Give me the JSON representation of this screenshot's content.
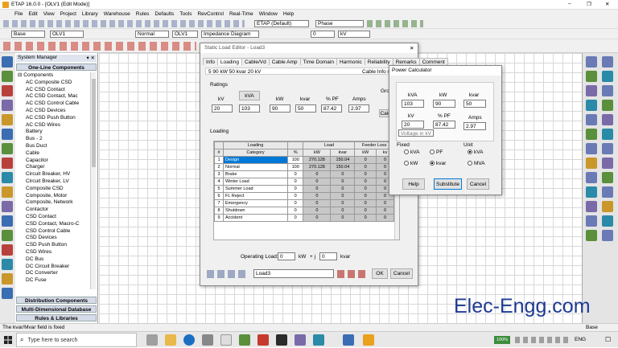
{
  "app": {
    "title": "ETAP 16.0.0 - [OLV1 (Edit Mode)]",
    "win_min": "–",
    "win_max": "❐",
    "win_close": "✕"
  },
  "menu": [
    "File",
    "Edit",
    "View",
    "Project",
    "Library",
    "Warehouse",
    "Rules",
    "Defaults",
    "Tools",
    "RevControl",
    "Real-Time",
    "Window",
    "Help"
  ],
  "toolbar": {
    "base": "Base",
    "olv": "OLV1",
    "normal": "Normal",
    "olv2": "OLV1",
    "impedance": "Impedance Diagram",
    "etap_default": "ETAP (Default)",
    "phase": "Phase",
    "kv": "kV",
    "zoom_val": "0"
  },
  "sysmgr": {
    "title": "System Manager",
    "pin": "▾ ✕",
    "oneline": "One-Line Components",
    "components": "Components",
    "items": [
      "AC Composite CSD",
      "AC CSD Contact",
      "AC CSD Contact, Mac",
      "AC CSD Control Cable",
      "AC CSD Devices",
      "AC CSD Push Button",
      "AC CSD Wires",
      "Battery",
      "Bus - 2",
      "Bus Duct",
      "Cable",
      "Capacitor",
      "Charger",
      "Circuit Breaker, HV",
      "Circuit Breaker, LV",
      "Composite CSD",
      "Composite, Motor",
      "Composite, Network",
      "Contactor",
      "CSD Contact",
      "CSD Contact, Macro-C",
      "CSD Control Cable",
      "CSD Devices",
      "CSD Push Button",
      "CSD Wires",
      "DC Bus",
      "DC Circuit Breaker",
      "DC Converter",
      "DC Fuse"
    ],
    "distribution": "Distribution Components",
    "multidim": "Multi-Dimensional Database",
    "rules": "Rules & Libraries"
  },
  "sle": {
    "title": "Static Load Editor - Load3",
    "close": "✕",
    "tabs": [
      "Info",
      "Loading",
      "Cable/Vd",
      "Cable Amp",
      "Time Domain",
      "Harmonic",
      "Reliability",
      "Remarks",
      "Comment"
    ],
    "summary": "5  90 kW  50 kvar  20 kV",
    "cable_info": "Cable Info not a",
    "ratings": "Ratings",
    "rating_headers": [
      "kV",
      "kVA",
      "kW",
      "kvar",
      "% PF",
      "Amps"
    ],
    "rating_values": [
      "20",
      "103",
      "90",
      "50",
      "87.42",
      "2.97"
    ],
    "grou": "Grou",
    "calc": "Calc",
    "loading": "Loading",
    "table_top": [
      "",
      "Loading",
      "",
      "Load",
      "",
      "Feeder Loss",
      ""
    ],
    "table_headers": [
      "#",
      "Category",
      "%",
      "kW",
      "kvar",
      "kW",
      "kv"
    ],
    "rows": [
      [
        "1",
        "Design",
        "100",
        "270.128",
        "150.04",
        "0",
        "0"
      ],
      [
        "2",
        "Normal",
        "100",
        "270.128",
        "150.04",
        "0",
        "0"
      ],
      [
        "3",
        "Brake",
        "0",
        "0",
        "0",
        "0",
        "0"
      ],
      [
        "4",
        "Winter Load",
        "0",
        "0",
        "0",
        "0",
        "0"
      ],
      [
        "5",
        "Summer Load",
        "0",
        "0",
        "0",
        "0",
        "0"
      ],
      [
        "6",
        "FL Reject",
        "0",
        "0",
        "0",
        "0",
        "0"
      ],
      [
        "7",
        "Emergency",
        "0",
        "0",
        "0",
        "0",
        "0"
      ],
      [
        "8",
        "Shutdown",
        "0",
        "0",
        "0",
        "0",
        "0"
      ],
      [
        "9",
        "Accident",
        "0",
        "0",
        "0",
        "0",
        "0"
      ]
    ],
    "operating": "Operating Load:",
    "op_kw": "0",
    "kw": "kW",
    "plus_j": "+ j",
    "op_kvar": "0",
    "kvar": "kvar",
    "load_select": "Load3",
    "ok": "OK",
    "cancel": "Cancel",
    "help": "?"
  },
  "pc": {
    "title": "Power Calculator",
    "top_labels": [
      "kVA",
      "kW",
      "kvar"
    ],
    "top_values": [
      "103",
      "90",
      "50"
    ],
    "bot_labels": [
      "kV",
      "% PF",
      "Amps"
    ],
    "bot_values": [
      "20",
      "87.42",
      "2.97"
    ],
    "tooltip": "Voltage in kV",
    "fixed": "Fixed",
    "unit": "Unit",
    "r_kva": "kVA",
    "r_pf": "PF",
    "r_kw": "kW",
    "r_kvar": "kvar",
    "r_ukva": "kVA",
    "r_mva": "MVA",
    "help": "Help",
    "substitute": "Substitute",
    "cancel": "Cancel"
  },
  "watermark": "Elec-Engg.com",
  "status": {
    "left": "The kvar/Mvar field is fixed",
    "right": "Base"
  },
  "taskbar": {
    "search": "Type here to search",
    "zoom": "100%",
    "lang": "ENG",
    "time": "",
    "date": ""
  },
  "colors": {
    "accent": "#0078d7",
    "title_bg": "#ffffff",
    "selected": "#0078d7",
    "watermark": "#1f3a93"
  }
}
